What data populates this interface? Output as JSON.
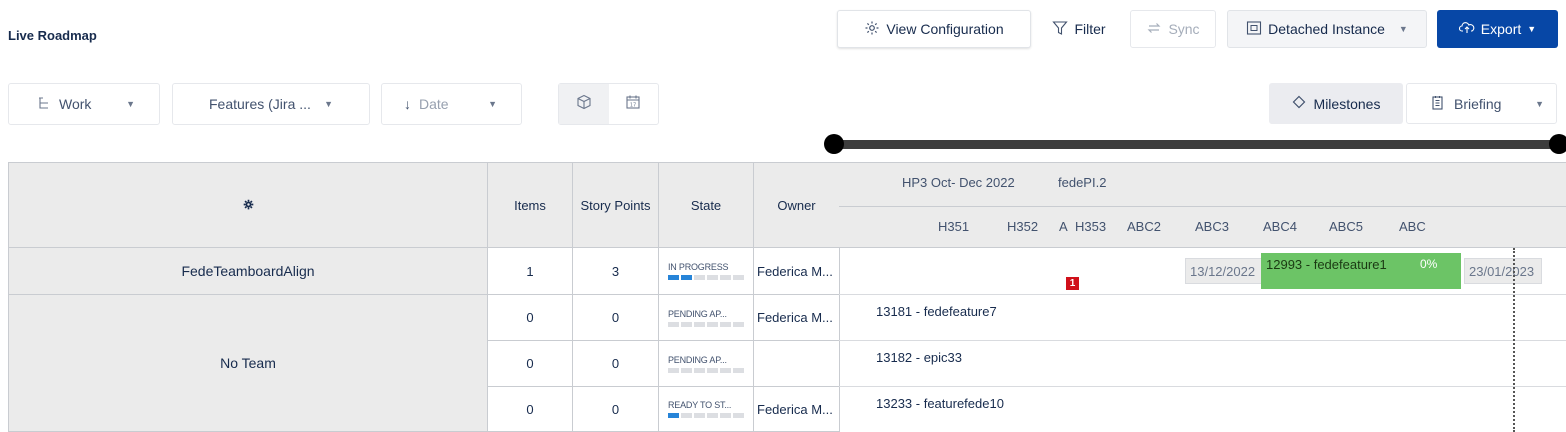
{
  "app": {
    "title": "Live Roadmap"
  },
  "toolbar": {
    "view_configuration": "View Configuration",
    "filter": "Filter",
    "sync": "Sync",
    "detached_instance": "Detached Instance",
    "export": "Export"
  },
  "controls": {
    "work": "Work",
    "features": "Features (Jira ...",
    "date": "Date",
    "milestones": "Milestones",
    "briefing": "Briefing"
  },
  "table": {
    "columns": {
      "items": "Items",
      "story_points": "Story Points",
      "state": "State",
      "owner": "Owner"
    },
    "rows": [
      {
        "team": "FedeTeamboardAlign",
        "items": "1",
        "story_points": "3",
        "state": "IN PROGRESS",
        "state_progress": 2,
        "owner": "Federica M..."
      },
      {
        "team": "No Team",
        "items": "0",
        "story_points": "0",
        "state": "PENDING AP...",
        "state_progress": 0,
        "owner": "Federica M..."
      },
      {
        "team": "",
        "items": "0",
        "story_points": "0",
        "state": "PENDING AP...",
        "state_progress": 0,
        "owner": ""
      },
      {
        "team": "",
        "items": "0",
        "story_points": "0",
        "state": "READY TO ST...",
        "state_progress": 1,
        "owner": "Federica M..."
      }
    ]
  },
  "timeline": {
    "increments": [
      "HP3 Oct- Dec 2022",
      "fedePI.2"
    ],
    "iterations": [
      "H351",
      "H352",
      "A",
      "H353",
      "ABC2",
      "ABC3",
      "ABC4",
      "ABC5",
      "ABC"
    ],
    "feature": {
      "title": "12993 - fedefeature1",
      "progress": "0%",
      "start": "13/12/2022",
      "end": "23/01/2023",
      "color": "#6cc466"
    },
    "badge": "1",
    "items": [
      "13181 - fedefeature7",
      "13182 - epic33",
      "13233 - featurefede10"
    ]
  },
  "colors": {
    "export_button": "#0747a6",
    "state_progress": "#2684d8",
    "badge": "#d0101a"
  }
}
